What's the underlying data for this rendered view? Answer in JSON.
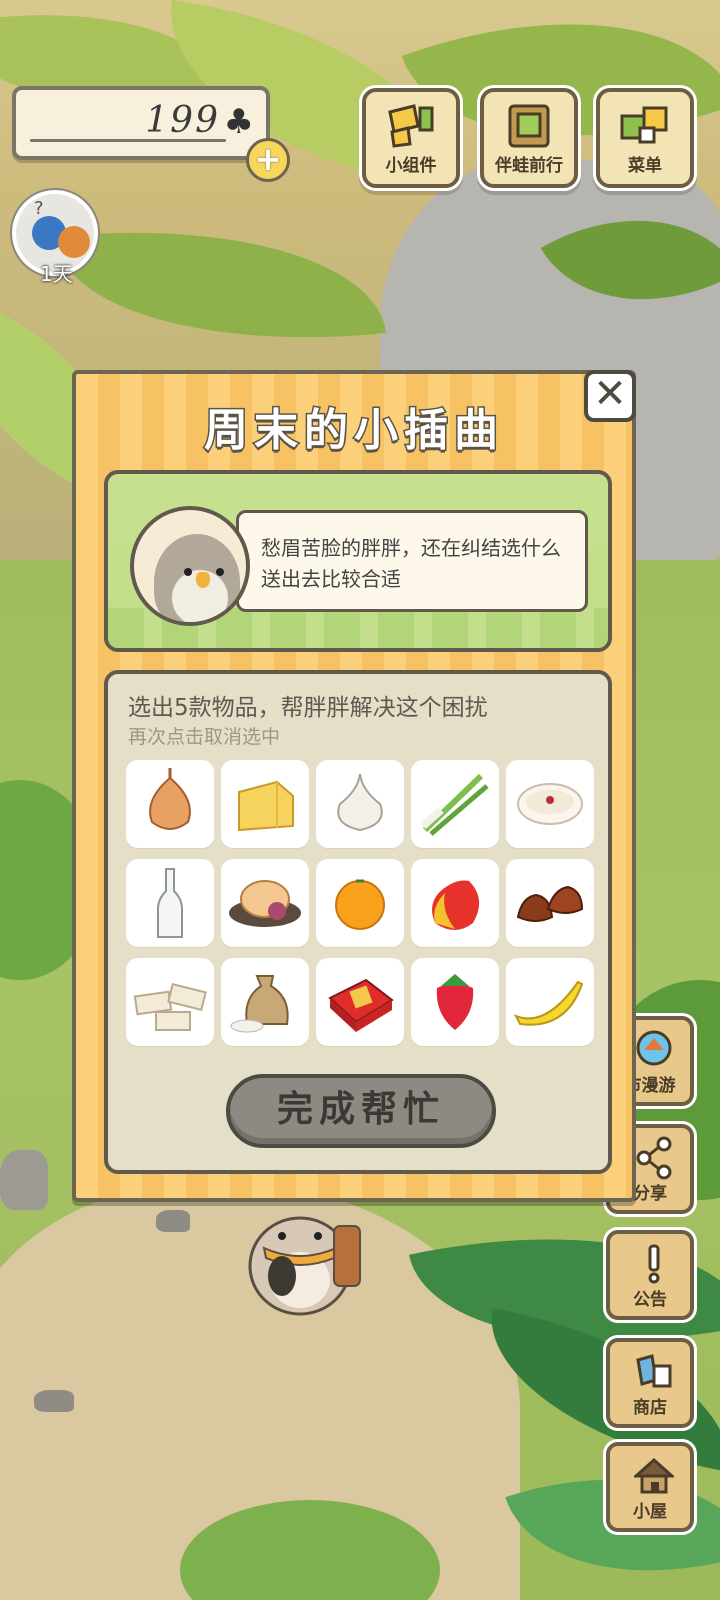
{
  "hud": {
    "clover_count": "199",
    "clover_icon": "clover-icon",
    "days_label": "1天",
    "buttons": [
      {
        "label": "小组件",
        "icon": "widget-icon"
      },
      {
        "label": "伴蛙前行",
        "icon": "frog-journey-icon"
      },
      {
        "label": "菜单",
        "icon": "menu-icon"
      }
    ]
  },
  "side_buttons": [
    {
      "label": "市漫游",
      "icon": "city-roam-icon"
    },
    {
      "label": "分享",
      "icon": "share-icon"
    },
    {
      "label": "公告",
      "icon": "notice-icon"
    },
    {
      "label": "商店",
      "icon": "shop-icon"
    },
    {
      "label": "小屋",
      "icon": "house-icon"
    }
  ],
  "dialog": {
    "title": "周末的小插曲",
    "close_icon": "close-icon",
    "speech": "愁眉苦脸的胖胖，还在纠结选什么送出去比较合适",
    "task_title": "选出5款物品，帮胖胖解决这个困扰",
    "task_hint": "再次点击取消选中",
    "items": [
      "onion",
      "cheese",
      "garlic",
      "green-onion",
      "rice-porridge",
      "glass-bottle",
      "mooncake",
      "orange",
      "mango",
      "chestnuts",
      "nougat",
      "rice-sack",
      "gift-box",
      "strawberry",
      "banana"
    ],
    "confirm_label": "完成帮忙"
  },
  "colors": {
    "dialog_stripe_a": "#fcd07a",
    "dialog_stripe_b": "#f7c263",
    "story_green": "#c6e090",
    "task_bg": "#e6dfc8",
    "button_disabled": "#8d8a84"
  }
}
